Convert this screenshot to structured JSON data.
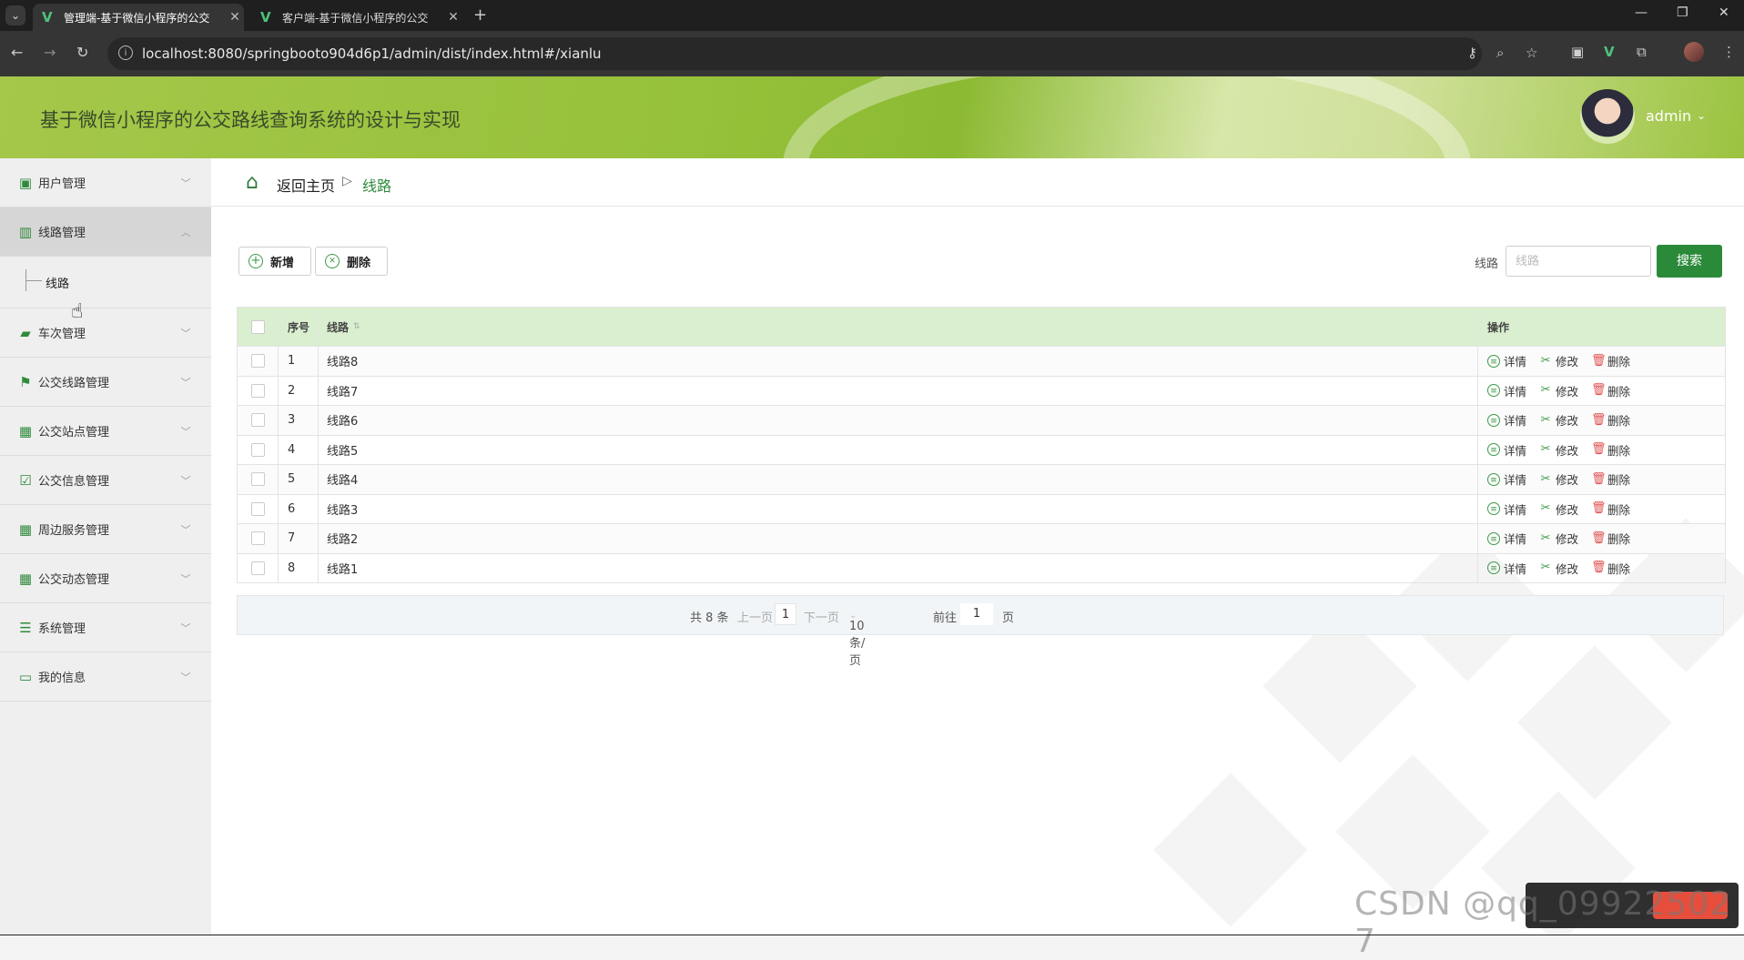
{
  "browser": {
    "tabs": [
      {
        "title": "管理端-基于微信小程序的公交",
        "active": true
      },
      {
        "title": "客户端-基于微信小程序的公交",
        "active": false
      }
    ],
    "url": "localhost:8080/springbooto904d6p1/admin/dist/index.html#/xianlu"
  },
  "header": {
    "title": "基于微信小程序的公交路线查询系统的设计与实现",
    "user": "admin"
  },
  "sidebar": {
    "items": [
      {
        "label": "用户管理",
        "icon": "user-icon",
        "open": false
      },
      {
        "label": "线路管理",
        "icon": "route-icon",
        "open": true,
        "children": [
          "线路"
        ]
      },
      {
        "label": "车次管理",
        "icon": "bus-icon",
        "open": false
      },
      {
        "label": "公交线路管理",
        "icon": "flag-icon",
        "open": false
      },
      {
        "label": "公交站点管理",
        "icon": "grid-icon",
        "open": false
      },
      {
        "label": "公交信息管理",
        "icon": "clipboard-icon",
        "open": false
      },
      {
        "label": "周边服务管理",
        "icon": "grid-icon",
        "open": false
      },
      {
        "label": "公交动态管理",
        "icon": "grid-icon",
        "open": false
      },
      {
        "label": "系统管理",
        "icon": "list-icon",
        "open": false
      },
      {
        "label": "我的信息",
        "icon": "card-icon",
        "open": false
      }
    ]
  },
  "breadcrumb": {
    "home": "返回主页",
    "separator": "▷",
    "current": "线路"
  },
  "toolbar": {
    "add_label": "新增",
    "delete_label": "删除",
    "search_label": "线路",
    "search_placeholder": "线路",
    "search_button": "搜索"
  },
  "table": {
    "headers": {
      "index": "序号",
      "name": "线路",
      "ops": "操作"
    },
    "rows": [
      {
        "index": "1",
        "name": "线路8"
      },
      {
        "index": "2",
        "name": "线路7"
      },
      {
        "index": "3",
        "name": "线路6"
      },
      {
        "index": "4",
        "name": "线路5"
      },
      {
        "index": "5",
        "name": "线路4"
      },
      {
        "index": "6",
        "name": "线路3"
      },
      {
        "index": "7",
        "name": "线路2"
      },
      {
        "index": "8",
        "name": "线路1"
      }
    ],
    "ops": {
      "detail": "详情",
      "edit": "修改",
      "delete": "删除"
    }
  },
  "pagination": {
    "total": "共 8 条",
    "prev": "上一页",
    "page": "1",
    "next": "下一页",
    "page_size": "10条/页",
    "goto": "前往",
    "goto_value": "1",
    "page_unit": "页"
  },
  "watermark": "CSDN @qq_09922502 7",
  "colors": {
    "accent": "#2a8a3a",
    "header_green": "#96c13a",
    "table_header": "#d9efcf"
  }
}
